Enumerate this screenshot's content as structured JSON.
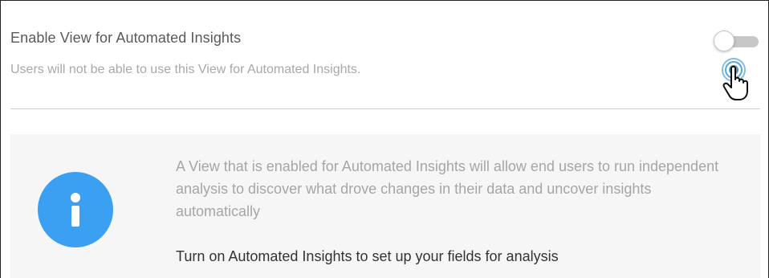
{
  "setting": {
    "title": "Enable View for Automated Insights",
    "description": "Users will not be able to use this View for Automated Insights.",
    "toggle_state": "off"
  },
  "info_panel": {
    "icon": "info-icon",
    "text": "A View that is enabled for Automated Insights will allow end users to run independent analysis to discover what drove changes in their data and uncover insights automatically",
    "cta": "Turn on Automated Insights to set up your fields for analysis"
  },
  "colors": {
    "info_icon": "#3ca0f2",
    "panel_bg": "#f6f6f6",
    "toggle_track": "#c7c7c7",
    "cursor_ripple": "#1e88c8"
  }
}
